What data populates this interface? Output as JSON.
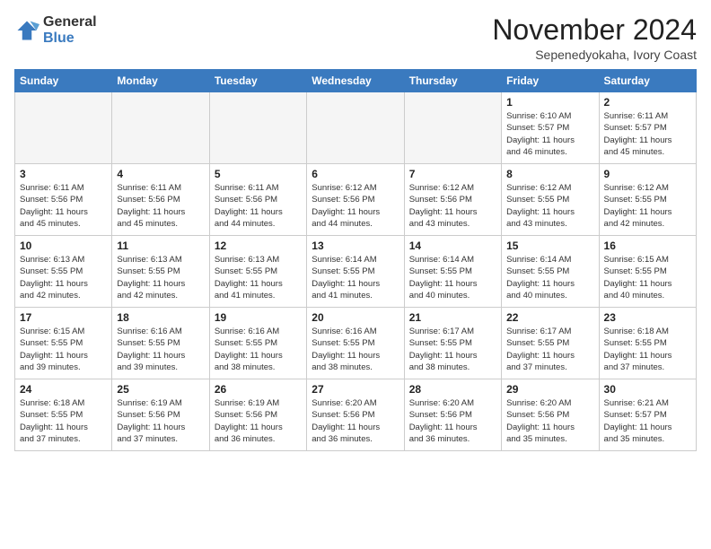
{
  "header": {
    "logo_general": "General",
    "logo_blue": "Blue",
    "month_title": "November 2024",
    "location": "Sepenedyokaha, Ivory Coast"
  },
  "weekdays": [
    "Sunday",
    "Monday",
    "Tuesday",
    "Wednesday",
    "Thursday",
    "Friday",
    "Saturday"
  ],
  "weeks": [
    [
      {
        "day": "",
        "info": "",
        "empty": true
      },
      {
        "day": "",
        "info": "",
        "empty": true
      },
      {
        "day": "",
        "info": "",
        "empty": true
      },
      {
        "day": "",
        "info": "",
        "empty": true
      },
      {
        "day": "",
        "info": "",
        "empty": true
      },
      {
        "day": "1",
        "info": "Sunrise: 6:10 AM\nSunset: 5:57 PM\nDaylight: 11 hours\nand 46 minutes."
      },
      {
        "day": "2",
        "info": "Sunrise: 6:11 AM\nSunset: 5:57 PM\nDaylight: 11 hours\nand 45 minutes."
      }
    ],
    [
      {
        "day": "3",
        "info": "Sunrise: 6:11 AM\nSunset: 5:56 PM\nDaylight: 11 hours\nand 45 minutes."
      },
      {
        "day": "4",
        "info": "Sunrise: 6:11 AM\nSunset: 5:56 PM\nDaylight: 11 hours\nand 45 minutes."
      },
      {
        "day": "5",
        "info": "Sunrise: 6:11 AM\nSunset: 5:56 PM\nDaylight: 11 hours\nand 44 minutes."
      },
      {
        "day": "6",
        "info": "Sunrise: 6:12 AM\nSunset: 5:56 PM\nDaylight: 11 hours\nand 44 minutes."
      },
      {
        "day": "7",
        "info": "Sunrise: 6:12 AM\nSunset: 5:56 PM\nDaylight: 11 hours\nand 43 minutes."
      },
      {
        "day": "8",
        "info": "Sunrise: 6:12 AM\nSunset: 5:55 PM\nDaylight: 11 hours\nand 43 minutes."
      },
      {
        "day": "9",
        "info": "Sunrise: 6:12 AM\nSunset: 5:55 PM\nDaylight: 11 hours\nand 42 minutes."
      }
    ],
    [
      {
        "day": "10",
        "info": "Sunrise: 6:13 AM\nSunset: 5:55 PM\nDaylight: 11 hours\nand 42 minutes."
      },
      {
        "day": "11",
        "info": "Sunrise: 6:13 AM\nSunset: 5:55 PM\nDaylight: 11 hours\nand 42 minutes."
      },
      {
        "day": "12",
        "info": "Sunrise: 6:13 AM\nSunset: 5:55 PM\nDaylight: 11 hours\nand 41 minutes."
      },
      {
        "day": "13",
        "info": "Sunrise: 6:14 AM\nSunset: 5:55 PM\nDaylight: 11 hours\nand 41 minutes."
      },
      {
        "day": "14",
        "info": "Sunrise: 6:14 AM\nSunset: 5:55 PM\nDaylight: 11 hours\nand 40 minutes."
      },
      {
        "day": "15",
        "info": "Sunrise: 6:14 AM\nSunset: 5:55 PM\nDaylight: 11 hours\nand 40 minutes."
      },
      {
        "day": "16",
        "info": "Sunrise: 6:15 AM\nSunset: 5:55 PM\nDaylight: 11 hours\nand 40 minutes."
      }
    ],
    [
      {
        "day": "17",
        "info": "Sunrise: 6:15 AM\nSunset: 5:55 PM\nDaylight: 11 hours\nand 39 minutes."
      },
      {
        "day": "18",
        "info": "Sunrise: 6:16 AM\nSunset: 5:55 PM\nDaylight: 11 hours\nand 39 minutes."
      },
      {
        "day": "19",
        "info": "Sunrise: 6:16 AM\nSunset: 5:55 PM\nDaylight: 11 hours\nand 38 minutes."
      },
      {
        "day": "20",
        "info": "Sunrise: 6:16 AM\nSunset: 5:55 PM\nDaylight: 11 hours\nand 38 minutes."
      },
      {
        "day": "21",
        "info": "Sunrise: 6:17 AM\nSunset: 5:55 PM\nDaylight: 11 hours\nand 38 minutes."
      },
      {
        "day": "22",
        "info": "Sunrise: 6:17 AM\nSunset: 5:55 PM\nDaylight: 11 hours\nand 37 minutes."
      },
      {
        "day": "23",
        "info": "Sunrise: 6:18 AM\nSunset: 5:55 PM\nDaylight: 11 hours\nand 37 minutes."
      }
    ],
    [
      {
        "day": "24",
        "info": "Sunrise: 6:18 AM\nSunset: 5:55 PM\nDaylight: 11 hours\nand 37 minutes."
      },
      {
        "day": "25",
        "info": "Sunrise: 6:19 AM\nSunset: 5:56 PM\nDaylight: 11 hours\nand 37 minutes."
      },
      {
        "day": "26",
        "info": "Sunrise: 6:19 AM\nSunset: 5:56 PM\nDaylight: 11 hours\nand 36 minutes."
      },
      {
        "day": "27",
        "info": "Sunrise: 6:20 AM\nSunset: 5:56 PM\nDaylight: 11 hours\nand 36 minutes."
      },
      {
        "day": "28",
        "info": "Sunrise: 6:20 AM\nSunset: 5:56 PM\nDaylight: 11 hours\nand 36 minutes."
      },
      {
        "day": "29",
        "info": "Sunrise: 6:20 AM\nSunset: 5:56 PM\nDaylight: 11 hours\nand 35 minutes."
      },
      {
        "day": "30",
        "info": "Sunrise: 6:21 AM\nSunset: 5:57 PM\nDaylight: 11 hours\nand 35 minutes."
      }
    ]
  ]
}
